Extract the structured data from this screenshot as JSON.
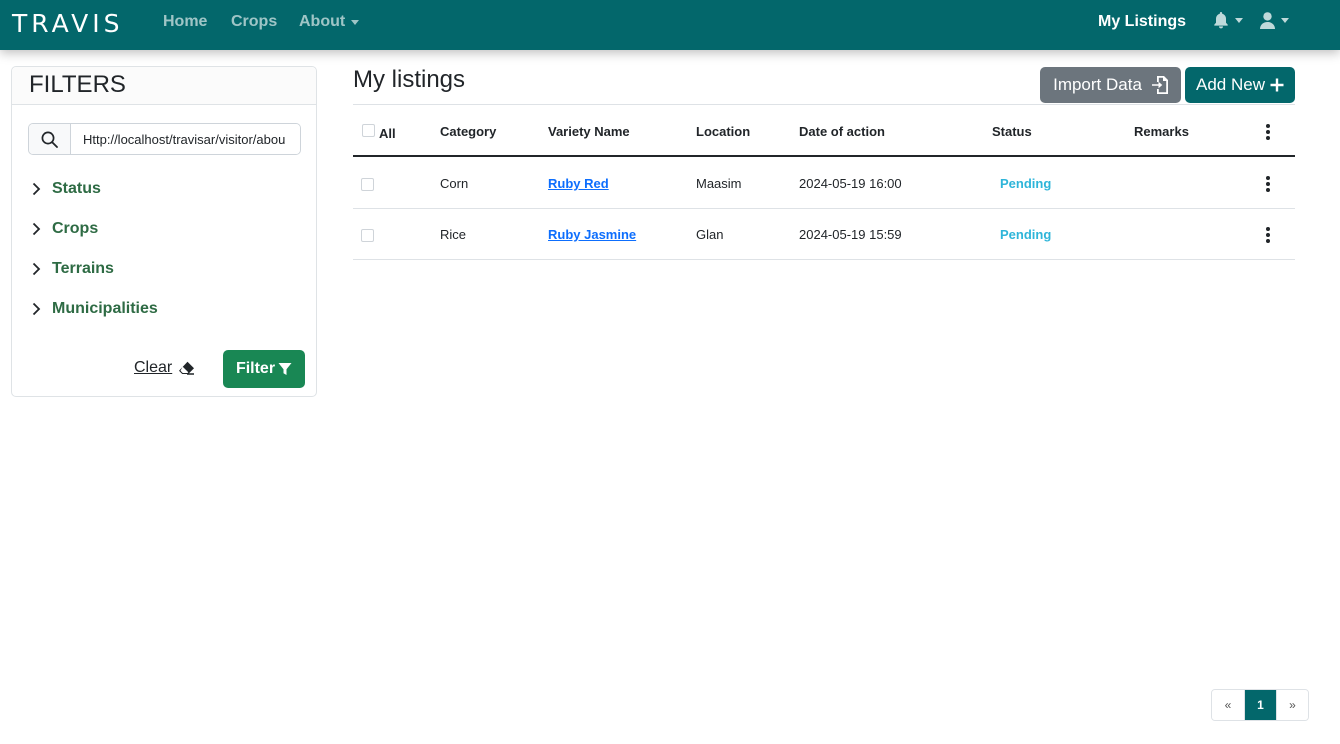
{
  "navbar": {
    "brand": "TRAVIS",
    "links": {
      "home": "Home",
      "crops": "Crops",
      "about": "About"
    },
    "my_listings": "My Listings",
    "icons": [
      "bell-icon",
      "user-icon"
    ]
  },
  "filters": {
    "title": "FILTERS",
    "search_value": "Http://localhost/travisar/visitor/abou",
    "items": [
      "Status",
      "Crops",
      "Terrains",
      "Municipalities"
    ],
    "clear_label": "Clear",
    "filter_label": "Filter"
  },
  "main": {
    "title": "My listings",
    "import_label": "Import Data",
    "add_label": "Add New",
    "table": {
      "headers": {
        "all": "All",
        "category": "Category",
        "variety": "Variety Name",
        "location": "Location",
        "date": "Date of action",
        "status": "Status",
        "remarks": "Remarks"
      },
      "rows": [
        {
          "category": "Corn",
          "variety": "Ruby Red",
          "location": "Maasim",
          "date": "2024-05-19 16:00",
          "status": "Pending",
          "remarks": ""
        },
        {
          "category": "Rice",
          "variety": "Ruby Jasmine",
          "location": "Glan",
          "date": "2024-05-19 15:59",
          "status": "Pending",
          "remarks": ""
        }
      ]
    }
  },
  "pagination": {
    "prev": "«",
    "current": "1",
    "next": "»"
  },
  "colors": {
    "primary": "#03676b",
    "success": "#198754",
    "secondary": "#6c757d",
    "link": "#0d6efd",
    "status_pending": "#2eb5d9",
    "filter_text": "#2e6b44"
  }
}
